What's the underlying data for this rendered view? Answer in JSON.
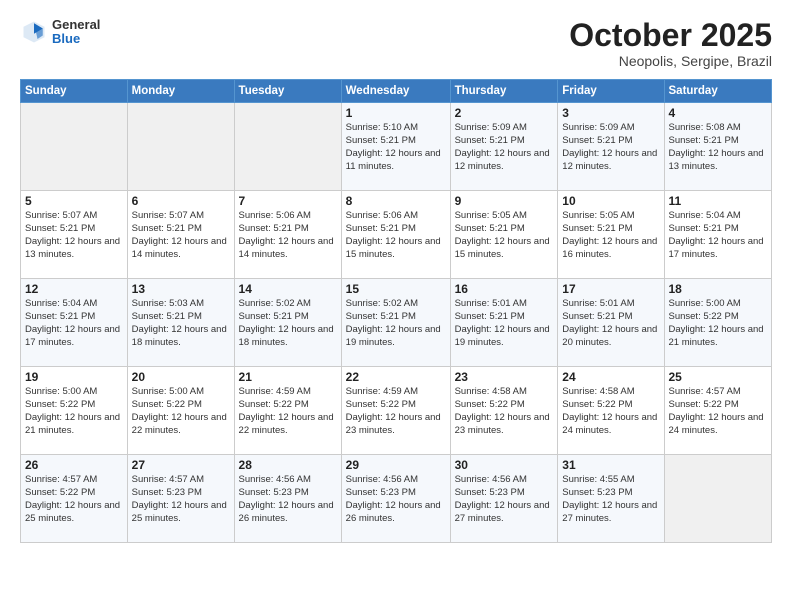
{
  "header": {
    "logo_general": "General",
    "logo_blue": "Blue",
    "month_title": "October 2025",
    "location": "Neopolis, Sergipe, Brazil"
  },
  "weekdays": [
    "Sunday",
    "Monday",
    "Tuesday",
    "Wednesday",
    "Thursday",
    "Friday",
    "Saturday"
  ],
  "weeks": [
    [
      {
        "day": "",
        "sunrise": "",
        "sunset": "",
        "daylight": "",
        "empty": true
      },
      {
        "day": "",
        "sunrise": "",
        "sunset": "",
        "daylight": "",
        "empty": true
      },
      {
        "day": "",
        "sunrise": "",
        "sunset": "",
        "daylight": "",
        "empty": true
      },
      {
        "day": "1",
        "sunrise": "Sunrise: 5:10 AM",
        "sunset": "Sunset: 5:21 PM",
        "daylight": "Daylight: 12 hours and 11 minutes."
      },
      {
        "day": "2",
        "sunrise": "Sunrise: 5:09 AM",
        "sunset": "Sunset: 5:21 PM",
        "daylight": "Daylight: 12 hours and 12 minutes."
      },
      {
        "day": "3",
        "sunrise": "Sunrise: 5:09 AM",
        "sunset": "Sunset: 5:21 PM",
        "daylight": "Daylight: 12 hours and 12 minutes."
      },
      {
        "day": "4",
        "sunrise": "Sunrise: 5:08 AM",
        "sunset": "Sunset: 5:21 PM",
        "daylight": "Daylight: 12 hours and 13 minutes."
      }
    ],
    [
      {
        "day": "5",
        "sunrise": "Sunrise: 5:07 AM",
        "sunset": "Sunset: 5:21 PM",
        "daylight": "Daylight: 12 hours and 13 minutes."
      },
      {
        "day": "6",
        "sunrise": "Sunrise: 5:07 AM",
        "sunset": "Sunset: 5:21 PM",
        "daylight": "Daylight: 12 hours and 14 minutes."
      },
      {
        "day": "7",
        "sunrise": "Sunrise: 5:06 AM",
        "sunset": "Sunset: 5:21 PM",
        "daylight": "Daylight: 12 hours and 14 minutes."
      },
      {
        "day": "8",
        "sunrise": "Sunrise: 5:06 AM",
        "sunset": "Sunset: 5:21 PM",
        "daylight": "Daylight: 12 hours and 15 minutes."
      },
      {
        "day": "9",
        "sunrise": "Sunrise: 5:05 AM",
        "sunset": "Sunset: 5:21 PM",
        "daylight": "Daylight: 12 hours and 15 minutes."
      },
      {
        "day": "10",
        "sunrise": "Sunrise: 5:05 AM",
        "sunset": "Sunset: 5:21 PM",
        "daylight": "Daylight: 12 hours and 16 minutes."
      },
      {
        "day": "11",
        "sunrise": "Sunrise: 5:04 AM",
        "sunset": "Sunset: 5:21 PM",
        "daylight": "Daylight: 12 hours and 17 minutes."
      }
    ],
    [
      {
        "day": "12",
        "sunrise": "Sunrise: 5:04 AM",
        "sunset": "Sunset: 5:21 PM",
        "daylight": "Daylight: 12 hours and 17 minutes."
      },
      {
        "day": "13",
        "sunrise": "Sunrise: 5:03 AM",
        "sunset": "Sunset: 5:21 PM",
        "daylight": "Daylight: 12 hours and 18 minutes."
      },
      {
        "day": "14",
        "sunrise": "Sunrise: 5:02 AM",
        "sunset": "Sunset: 5:21 PM",
        "daylight": "Daylight: 12 hours and 18 minutes."
      },
      {
        "day": "15",
        "sunrise": "Sunrise: 5:02 AM",
        "sunset": "Sunset: 5:21 PM",
        "daylight": "Daylight: 12 hours and 19 minutes."
      },
      {
        "day": "16",
        "sunrise": "Sunrise: 5:01 AM",
        "sunset": "Sunset: 5:21 PM",
        "daylight": "Daylight: 12 hours and 19 minutes."
      },
      {
        "day": "17",
        "sunrise": "Sunrise: 5:01 AM",
        "sunset": "Sunset: 5:21 PM",
        "daylight": "Daylight: 12 hours and 20 minutes."
      },
      {
        "day": "18",
        "sunrise": "Sunrise: 5:00 AM",
        "sunset": "Sunset: 5:22 PM",
        "daylight": "Daylight: 12 hours and 21 minutes."
      }
    ],
    [
      {
        "day": "19",
        "sunrise": "Sunrise: 5:00 AM",
        "sunset": "Sunset: 5:22 PM",
        "daylight": "Daylight: 12 hours and 21 minutes."
      },
      {
        "day": "20",
        "sunrise": "Sunrise: 5:00 AM",
        "sunset": "Sunset: 5:22 PM",
        "daylight": "Daylight: 12 hours and 22 minutes."
      },
      {
        "day": "21",
        "sunrise": "Sunrise: 4:59 AM",
        "sunset": "Sunset: 5:22 PM",
        "daylight": "Daylight: 12 hours and 22 minutes."
      },
      {
        "day": "22",
        "sunrise": "Sunrise: 4:59 AM",
        "sunset": "Sunset: 5:22 PM",
        "daylight": "Daylight: 12 hours and 23 minutes."
      },
      {
        "day": "23",
        "sunrise": "Sunrise: 4:58 AM",
        "sunset": "Sunset: 5:22 PM",
        "daylight": "Daylight: 12 hours and 23 minutes."
      },
      {
        "day": "24",
        "sunrise": "Sunrise: 4:58 AM",
        "sunset": "Sunset: 5:22 PM",
        "daylight": "Daylight: 12 hours and 24 minutes."
      },
      {
        "day": "25",
        "sunrise": "Sunrise: 4:57 AM",
        "sunset": "Sunset: 5:22 PM",
        "daylight": "Daylight: 12 hours and 24 minutes."
      }
    ],
    [
      {
        "day": "26",
        "sunrise": "Sunrise: 4:57 AM",
        "sunset": "Sunset: 5:22 PM",
        "daylight": "Daylight: 12 hours and 25 minutes."
      },
      {
        "day": "27",
        "sunrise": "Sunrise: 4:57 AM",
        "sunset": "Sunset: 5:23 PM",
        "daylight": "Daylight: 12 hours and 25 minutes."
      },
      {
        "day": "28",
        "sunrise": "Sunrise: 4:56 AM",
        "sunset": "Sunset: 5:23 PM",
        "daylight": "Daylight: 12 hours and 26 minutes."
      },
      {
        "day": "29",
        "sunrise": "Sunrise: 4:56 AM",
        "sunset": "Sunset: 5:23 PM",
        "daylight": "Daylight: 12 hours and 26 minutes."
      },
      {
        "day": "30",
        "sunrise": "Sunrise: 4:56 AM",
        "sunset": "Sunset: 5:23 PM",
        "daylight": "Daylight: 12 hours and 27 minutes."
      },
      {
        "day": "31",
        "sunrise": "Sunrise: 4:55 AM",
        "sunset": "Sunset: 5:23 PM",
        "daylight": "Daylight: 12 hours and 27 minutes."
      },
      {
        "day": "",
        "sunrise": "",
        "sunset": "",
        "daylight": "",
        "empty": true
      }
    ]
  ]
}
